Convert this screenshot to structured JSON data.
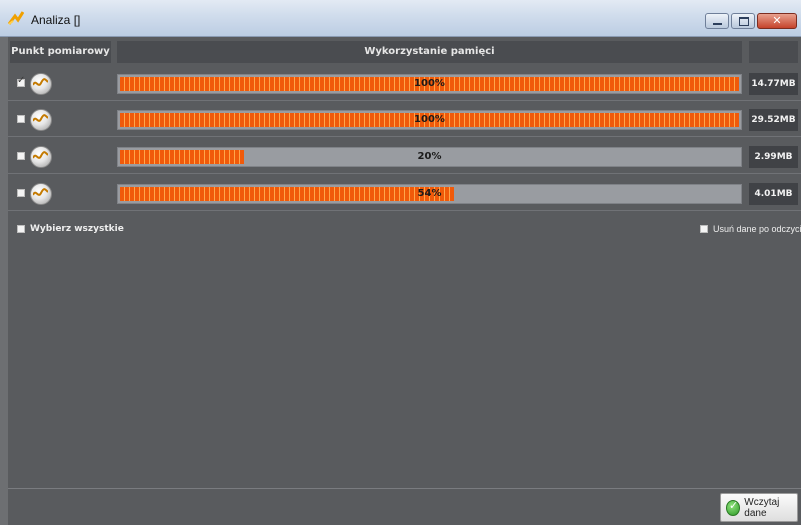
{
  "window": {
    "title": "Analiza []",
    "icon": "analysis-app-icon"
  },
  "table": {
    "headers": {
      "point": "Punkt pomiarowy",
      "memory_usage": "Wykorzystanie pamięci",
      "size": ""
    },
    "rows": [
      {
        "checked": true,
        "icon": "analyzer-device-icon",
        "percent": 1.0,
        "percent_label": "100%",
        "size": "14.77MB"
      },
      {
        "checked": false,
        "icon": "analyzer-device-icon",
        "percent": 1.0,
        "percent_label": "100%",
        "size": "29.52MB"
      },
      {
        "checked": false,
        "icon": "analyzer-device-icon",
        "percent": 0.2,
        "percent_label": "20%",
        "size": "2.99MB"
      },
      {
        "checked": false,
        "icon": "analyzer-device-icon",
        "percent": 0.54,
        "percent_label": "54%",
        "size": "4.01MB"
      }
    ]
  },
  "select_all": {
    "label": "Wybierz wszystkie",
    "checked": false
  },
  "delete_after_read": {
    "label": "Usuń dane po odczycie",
    "checked": false
  },
  "load_button": {
    "label": "Wczytaj dane",
    "icon": "ok-check-icon"
  },
  "colors": {
    "progress_fill": "#f05a0a",
    "progress_track": "#999ca1",
    "panel_bg": "#595b5e"
  }
}
